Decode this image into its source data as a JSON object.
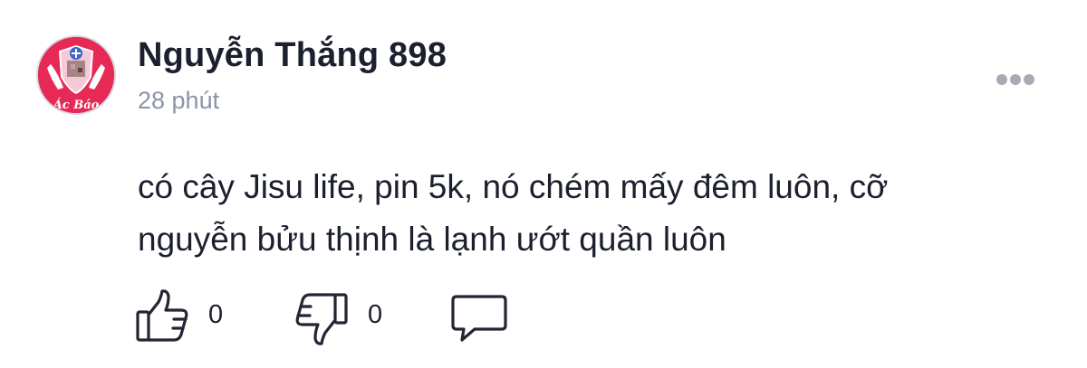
{
  "comment": {
    "author": "Nguyễn Thắng 898",
    "avatar_text": "Ác Báo",
    "timestamp": "28 phút",
    "text_lines": [
      "có cây Jisu life, pin 5k, nó chém mấy đêm luôn, cỡ",
      "nguyễn bửu thịnh là lạnh ướt quần luôn"
    ],
    "likes": "0",
    "dislikes": "0"
  },
  "icons": {
    "like": "thumbs-up-icon",
    "dislike": "thumbs-down-icon",
    "reply": "speech-bubble-icon",
    "more": "more-dots-icon"
  },
  "colors": {
    "text": "#1c1f2e",
    "muted": "#8e93a6",
    "avatar_bg": "#e62a55",
    "icon_stroke": "#222533"
  }
}
